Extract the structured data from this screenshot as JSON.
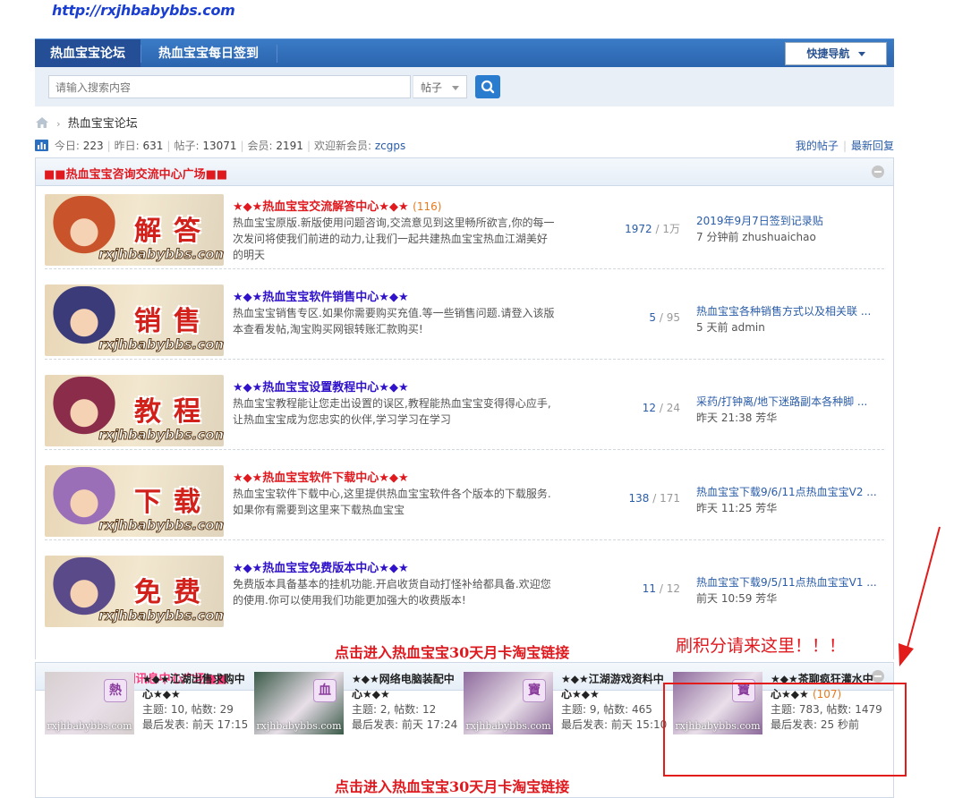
{
  "site_url": "http://rxjhbabybbs.com",
  "nav": {
    "tabs": [
      "热血宝宝论坛",
      "热血宝宝每日签到"
    ],
    "quick_nav": "快捷导航"
  },
  "search": {
    "placeholder": "请输入搜索内容",
    "type": "帖子"
  },
  "breadcrumb": {
    "current": "热血宝宝论坛"
  },
  "stats": {
    "today_label": "今日: ",
    "today": "223",
    "yesterday_label": "昨日: ",
    "yesterday": "631",
    "posts_label": "帖子: ",
    "posts": "13071",
    "members_label": "会员: ",
    "members": "2191",
    "newmember_label": "欢迎新会员: ",
    "newmember": "zcgps",
    "my_posts": "我的帖子",
    "latest_replies": "最新回复"
  },
  "section1": {
    "title": "■■热血宝宝咨询交流中心广场■■",
    "forums": [
      {
        "name": "★◆★热血宝宝交流解答中心★◆★",
        "name_color": "#e0191f",
        "count": "(116)",
        "desc": "热血宝宝原版.新版使用问题咨询,交流意见到这里畅所欲言,你的每一次发问将使我们前进的动力,让我们一起共建热血宝宝热血江湖美好的明天",
        "threads": "1972",
        "posts": "1万",
        "last_title": "2019年9月7日签到记录贴",
        "last_meta": "7 分钟前 zhushuaichao",
        "img_chars": "解答",
        "img_hue": "#c9542b"
      },
      {
        "name": "★◆★热血宝宝软件销售中心★◆★",
        "name_color": "#2f12c9",
        "count": "",
        "desc": "热血宝宝销售专区.如果你需要购买充值.等一些销售问题.请登入该版本查看发帖,淘宝购买网银转账汇款购买!",
        "threads": "5",
        "posts": "95",
        "last_title": "热血宝宝各种销售方式以及相关联 ...",
        "last_meta": "5 天前 admin",
        "img_chars": "销售",
        "img_hue": "#3b3b7a"
      },
      {
        "name": "★◆★热血宝宝设置教程中心★◆★",
        "name_color": "#2f12c9",
        "count": "",
        "desc": "热血宝宝教程能让您走出设置的误区,教程能热血宝宝变得得心应手,让热血宝宝成为您忠实的伙伴,学习学习在学习",
        "threads": "12",
        "posts": "24",
        "last_title": "采药/打钟离/地下迷路副本各种脚 ...",
        "last_meta": "昨天 21:38 芳华",
        "img_chars": "教程",
        "img_hue": "#8a2c4a"
      },
      {
        "name": "★◆★热血宝宝软件下载中心★◆★",
        "name_color": "#e0191f",
        "count": "",
        "desc": "热血宝宝软件下载中心,这里提供热血宝宝软件各个版本的下载服务.如果你有需要到这里来下载热血宝宝",
        "threads": "138",
        "posts": "171",
        "last_title": "热血宝宝下载9/6/11点热血宝宝V2 ...",
        "last_meta": "昨天 11:25 芳华",
        "img_chars": "下载",
        "img_hue": "#9a6fb8"
      },
      {
        "name": "★◆★热血宝宝免费版本中心★◆★",
        "name_color": "#2f12c9",
        "count": "",
        "desc": "免费版本具备基本的挂机功能.开启收货自动打怪补给都具备.欢迎您的使用.你可以使用我们功能更加强大的收费版本!",
        "threads": "11",
        "posts": "12",
        "last_title": "热血宝宝下载9/5/11点热血宝宝V1 ...",
        "last_meta": "前天 10:59 芳华",
        "img_chars": "免费",
        "img_hue": "#5a4a8a"
      }
    ],
    "img_watermark": "rxjhbabybbs.com"
  },
  "promo_text": "点击进入热血宝宝30天月卡淘宝链接",
  "annotation": "刷积分请来这里！！！",
  "section2": {
    "title": "■■热血宝宝江湖讯息中心广场■■",
    "subforums": [
      {
        "name": "★◆★江湖出售求购中心★◆★",
        "count": "",
        "topics_label": "主题: ",
        "topics": "10",
        "posts_label": "帖数: ",
        "posts": "29",
        "last_label": "最后发表: ",
        "last": "前天 17:15",
        "img_char": "熱",
        "img_bg": "#d6cfcf"
      },
      {
        "name": "★◆★网络电脑装配中心★◆★",
        "count": "",
        "topics_label": "主题: ",
        "topics": "2",
        "posts_label": "帖数: ",
        "posts": "12",
        "last_label": "最后发表: ",
        "last": "前天 17:24",
        "img_char": "血",
        "img_bg": "#3a5a48"
      },
      {
        "name": "★◆★江湖游戏资料中心★◆★",
        "count": "",
        "topics_label": "主题: ",
        "topics": "9",
        "posts_label": "帖数: ",
        "posts": "465",
        "last_label": "最后发表: ",
        "last": "前天 15:10",
        "img_char": "寶",
        "img_bg": "#8d6a9c"
      },
      {
        "name": "★◆★茶聊疯狂灌水中心★◆★",
        "count": "(107)",
        "topics_label": "主题: ",
        "topics": "783",
        "posts_label": "帖数: ",
        "posts": "1479",
        "last_label": "最后发表: ",
        "last": "25 秒前",
        "img_char": "寶",
        "img_bg": "#8d6a9c"
      }
    ],
    "img_watermark": "rxjhbabybbs.com"
  },
  "colors": {
    "nav_blue": "#2a63ad",
    "section_title_red": "#e0191f",
    "link_blue": "#2a5ca8",
    "highlight_box": "#e21b1b"
  }
}
